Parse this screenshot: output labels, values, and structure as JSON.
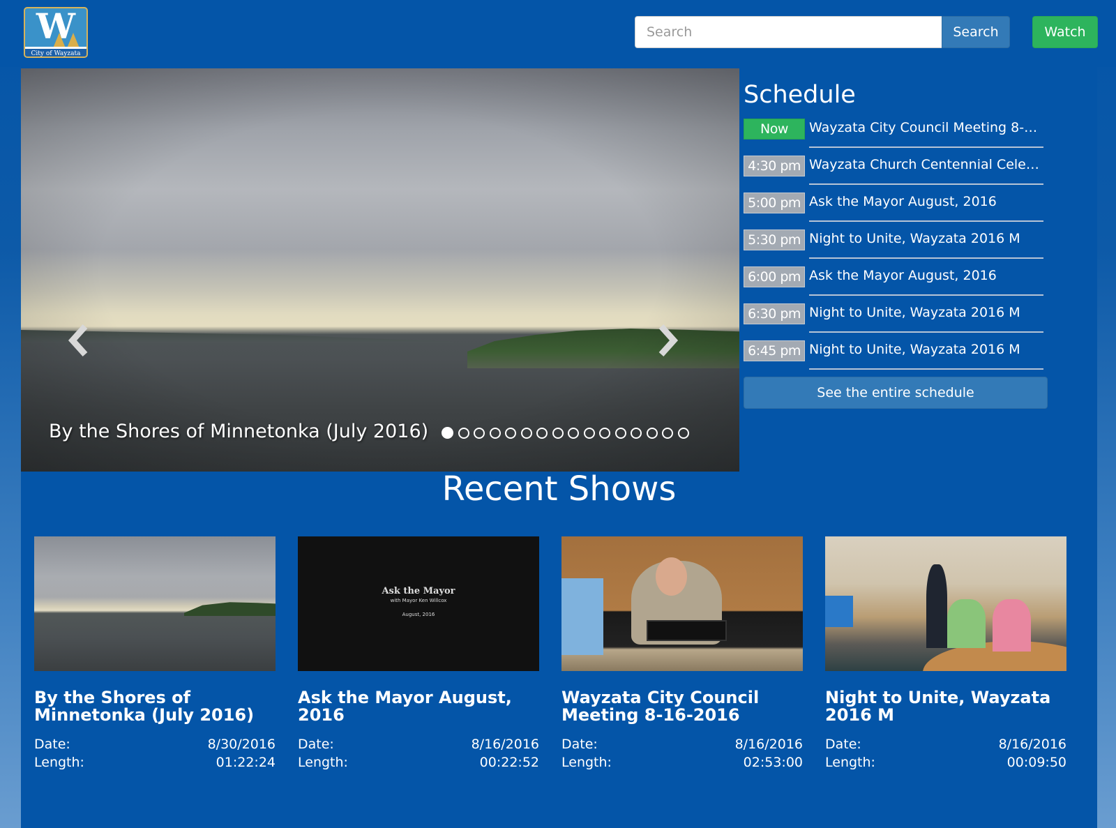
{
  "header": {
    "logo": {
      "letter": "W",
      "text": "City of Wayzata"
    },
    "search": {
      "placeholder": "Search",
      "value": "",
      "button_label": "Search"
    },
    "watch_label": "Watch"
  },
  "carousel": {
    "caption": "By the Shores of Minnetonka (July 2016)",
    "slide_count": 16,
    "active_index": 0,
    "prev_icon": "chevron-left-icon",
    "next_icon": "chevron-right-icon"
  },
  "schedule": {
    "title": "Schedule",
    "items": [
      {
        "time": "Now",
        "title": "Wayzata City Council Meeting 8-…",
        "is_now": true
      },
      {
        "time": "4:30 pm",
        "title": "Wayzata Church Centennial Cele…",
        "is_now": false
      },
      {
        "time": "5:00 pm",
        "title": "Ask the Mayor August, 2016",
        "is_now": false
      },
      {
        "time": "5:30 pm",
        "title": "Night to Unite, Wayzata 2016 M",
        "is_now": false
      },
      {
        "time": "6:00 pm",
        "title": "Ask the Mayor August, 2016",
        "is_now": false
      },
      {
        "time": "6:30 pm",
        "title": "Night to Unite, Wayzata 2016 M",
        "is_now": false
      },
      {
        "time": "6:45 pm",
        "title": "Night to Unite, Wayzata 2016 M",
        "is_now": false
      }
    ],
    "see_all_label": "See the entire schedule"
  },
  "recent": {
    "title": "Recent Shows",
    "date_label": "Date:",
    "length_label": "Length:",
    "shows": [
      {
        "title": "By the Shores of Minnetonka (July 2016)",
        "date": "8/30/2016",
        "length": "01:22:24"
      },
      {
        "title": "Ask the Mayor August, 2016",
        "date": "8/16/2016",
        "length": "00:22:52",
        "thumb_text": {
          "title": "Ask the Mayor",
          "subtitle": "with Mayor Ken Willcox",
          "date": "August, 2016"
        }
      },
      {
        "title": "Wayzata City Council Meeting 8-16-2016",
        "date": "8/16/2016",
        "length": "02:53:00"
      },
      {
        "title": "Night to Unite, Wayzata 2016 M",
        "date": "8/16/2016",
        "length": "00:09:50"
      }
    ]
  },
  "colors": {
    "primary_bg": "#0455a8",
    "button_blue": "#337ab7",
    "button_green": "#2db45d",
    "time_badge": "#a3aab3"
  }
}
